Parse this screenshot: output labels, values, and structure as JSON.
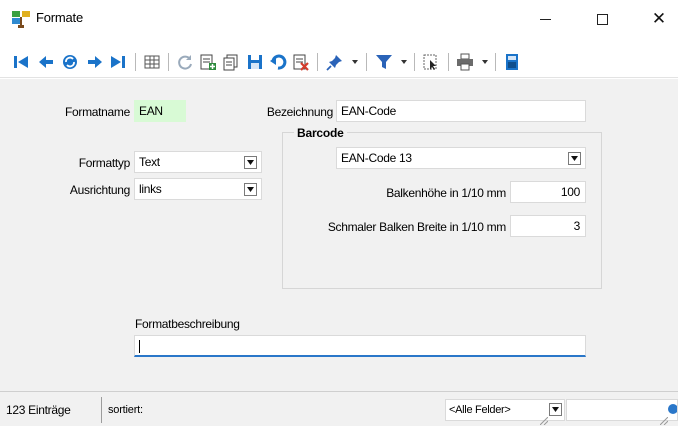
{
  "window": {
    "title": "Formate",
    "icon": "app-formate-icon"
  },
  "toolbar": {
    "buttons": [
      {
        "name": "first-record-icon",
        "color": "#1a73c9"
      },
      {
        "name": "previous-record-icon",
        "color": "#1a73c9"
      },
      {
        "name": "sync-icon",
        "color": "#1a73c9"
      },
      {
        "name": "next-record-icon",
        "color": "#1a73c9"
      },
      {
        "name": "last-record-icon",
        "color": "#1a73c9"
      },
      {
        "name": "table-view-icon",
        "color": "#555555"
      },
      {
        "name": "refresh-icon",
        "color": "#9aaabb"
      },
      {
        "name": "new-record-icon",
        "color": "#2e8b3d"
      },
      {
        "name": "copy-record-icon",
        "color": "#444444"
      },
      {
        "name": "save-icon",
        "color": "#1a73c9"
      },
      {
        "name": "undo-icon",
        "color": "#1a73c9"
      },
      {
        "name": "delete-icon",
        "color": "#d33b2c"
      },
      {
        "name": "pin-icon",
        "color": "#2a63b8"
      },
      {
        "name": "filter-icon",
        "color": "#2a63b8"
      },
      {
        "name": "select-cursor-icon",
        "color": "#666666"
      },
      {
        "name": "print-icon",
        "color": "#555555"
      },
      {
        "name": "calculator-icon",
        "color": "#1a73c9"
      }
    ]
  },
  "form": {
    "formatname_label": "Formatname",
    "formatname_value": "EAN",
    "bezeichnung_label": "Bezeichnung",
    "bezeichnung_value": "EAN-Code",
    "formattyp_label": "Formattyp",
    "formattyp_value": "Text",
    "ausrichtung_label": "Ausrichtung",
    "ausrichtung_value": "links",
    "barcode": {
      "title": "Barcode",
      "type_value": "EAN-Code 13",
      "height_label": "Balkenhöhe in 1/10 mm",
      "height_value": "100",
      "narrow_label": "Schmaler Balken Breite in 1/10 mm",
      "narrow_value": "3"
    },
    "description_label": "Formatbeschreibung",
    "description_value": ""
  },
  "statusbar": {
    "count": "123 Einträge",
    "sorted": "sortiert:",
    "field_filter": "<Alle Felder>",
    "search_value": ""
  },
  "colors": {
    "accent": "#2a77c9",
    "formatname_bg": "#d8fad5",
    "panel_bg": "#f1f1f1"
  }
}
